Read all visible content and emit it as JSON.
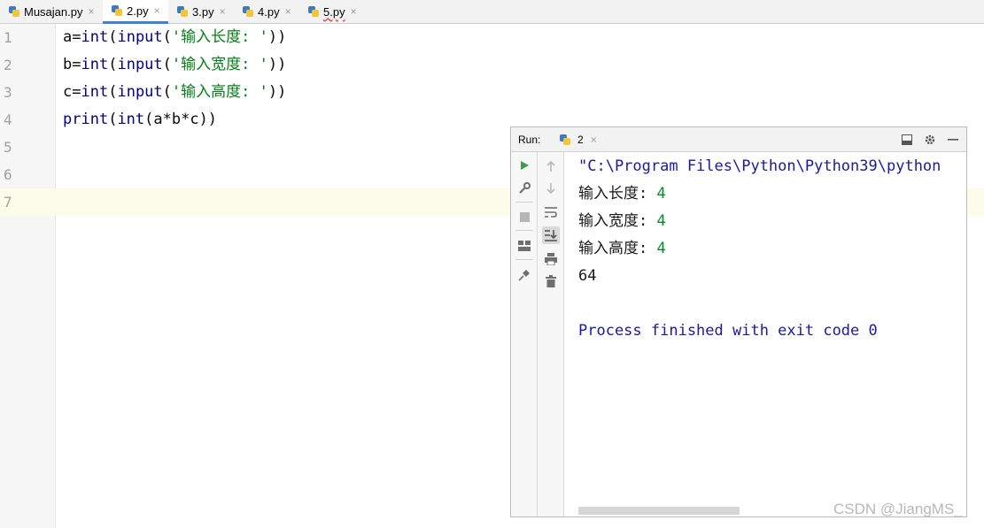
{
  "tabs": [
    {
      "label": "Musajan.py",
      "active": false
    },
    {
      "label": "2.py",
      "active": true
    },
    {
      "label": "3.py",
      "active": false
    },
    {
      "label": "4.py",
      "active": false
    },
    {
      "label": "5.py",
      "active": false
    }
  ],
  "tab_close_glyph": "×",
  "editor": {
    "line_numbers": [
      "1",
      "2",
      "3",
      "4",
      "5",
      "6",
      "7"
    ],
    "lines": [
      {
        "var": "a",
        "eq": "=",
        "f1": "int",
        "p1": "(",
        "f2": "input",
        "p2": "(",
        "str": "'输入长度: '",
        "close": "))"
      },
      {
        "var": "b",
        "eq": "=",
        "f1": "int",
        "p1": "(",
        "f2": "input",
        "p2": "(",
        "str": "'输入宽度: '",
        "close": "))"
      },
      {
        "var": "c",
        "eq": "=",
        "f1": "int",
        "p1": "(",
        "f2": "input",
        "p2": "(",
        "str": "'输入高度: '",
        "close": "))"
      },
      {
        "f0": "print",
        "p0": "(",
        "f1": "int",
        "rest": "(a*b*c))"
      }
    ]
  },
  "run": {
    "label": "Run:",
    "tab_label": "2",
    "tab_close": "×",
    "console": {
      "cmd": "\"C:\\Program Files\\Python\\Python39\\python",
      "prompt1": "输入长度: ",
      "value1": "4",
      "prompt2": "输入宽度: ",
      "value2": "4",
      "prompt3": "输入高度: ",
      "value3": "4",
      "result": "64",
      "finish": "Process finished with exit code 0"
    }
  },
  "icons": {
    "rerun": "play-icon",
    "wrench": "wrench-icon",
    "stop": "stop-icon",
    "layout": "layout-icon",
    "pin": "pin-icon",
    "up": "arrow-up-icon",
    "down": "arrow-down-icon",
    "wrap": "soft-wrap-icon",
    "scroll_end": "scroll-to-end-icon",
    "print": "print-icon",
    "trash": "trash-icon",
    "minimize_window": "window-icon",
    "settings": "gear-icon",
    "hide": "minus-icon"
  },
  "colors": {
    "keyword": "#000080",
    "string": "#067d17",
    "console_system": "#1a1a9c",
    "console_input": "#0a8a2a",
    "active_tab_underline": "#4083c9",
    "caret_line": "#fdfbe9"
  },
  "watermark": "CSDN @JiangMS_"
}
